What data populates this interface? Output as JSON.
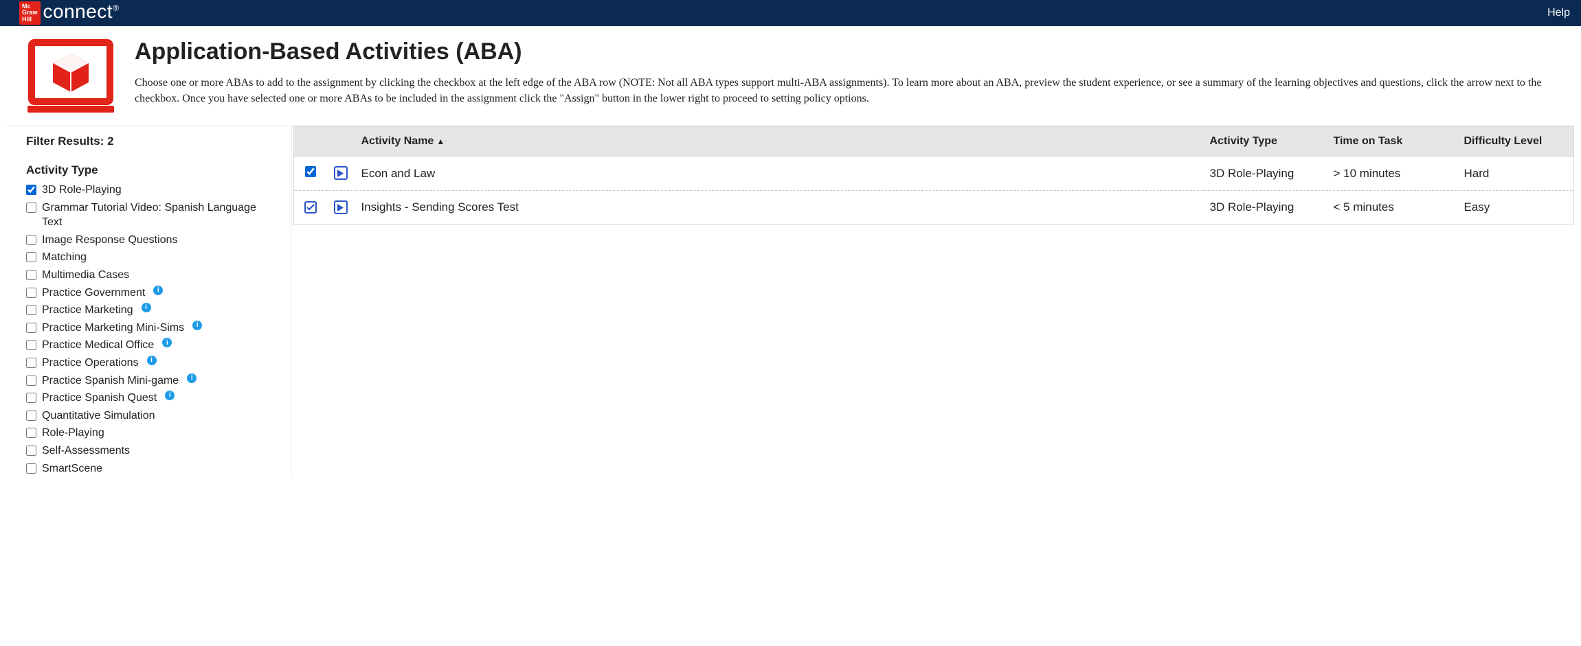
{
  "header": {
    "brand_tile": "Mc\nGraw\nHill",
    "brand_word": "connect",
    "help": "Help"
  },
  "page": {
    "title": "Application-Based Activities (ABA)",
    "description": "Choose one or more ABAs to add to the assignment by clicking the checkbox at the left edge of the ABA row (NOTE: Not all ABA types support multi-ABA assignments). To learn more about an ABA, preview the student experience, or see a summary of the learning objectives and questions, click the arrow next to the checkbox. Once you have selected one or more ABAs to be included in the assignment click the \"Assign\" button in the lower right to proceed to setting policy options."
  },
  "sidebar": {
    "heading": "Filter Results: 2",
    "section_title": "Activity Type",
    "filters": [
      {
        "label": "3D Role-Playing",
        "checked": true,
        "info": false
      },
      {
        "label": "Grammar Tutorial Video: Spanish Language Text",
        "checked": false,
        "info": false
      },
      {
        "label": "Image Response Questions",
        "checked": false,
        "info": false
      },
      {
        "label": "Matching",
        "checked": false,
        "info": false
      },
      {
        "label": "Multimedia Cases",
        "checked": false,
        "info": false
      },
      {
        "label": "Practice Government",
        "checked": false,
        "info": true
      },
      {
        "label": "Practice Marketing",
        "checked": false,
        "info": true
      },
      {
        "label": "Practice Marketing Mini-Sims",
        "checked": false,
        "info": true
      },
      {
        "label": "Practice Medical Office",
        "checked": false,
        "info": true
      },
      {
        "label": "Practice Operations",
        "checked": false,
        "info": true
      },
      {
        "label": "Practice Spanish Mini-game",
        "checked": false,
        "info": true
      },
      {
        "label": "Practice Spanish Quest",
        "checked": false,
        "info": true
      },
      {
        "label": "Quantitative Simulation",
        "checked": false,
        "info": false
      },
      {
        "label": "Role-Playing",
        "checked": false,
        "info": false
      },
      {
        "label": "Self-Assessments",
        "checked": false,
        "info": false
      },
      {
        "label": "SmartScene",
        "checked": false,
        "info": false
      }
    ]
  },
  "table": {
    "columns": {
      "name": "Activity Name",
      "type": "Activity Type",
      "time": "Time on Task",
      "diff": "Difficulty Level"
    },
    "rows": [
      {
        "selected": true,
        "outlined": false,
        "name": "Econ and Law",
        "type": "3D Role-Playing",
        "time": "> 10 minutes",
        "diff": "Hard"
      },
      {
        "selected": true,
        "outlined": true,
        "name": "Insights - Sending Scores Test",
        "type": "3D Role-Playing",
        "time": "< 5 minutes",
        "diff": "Easy"
      }
    ]
  }
}
